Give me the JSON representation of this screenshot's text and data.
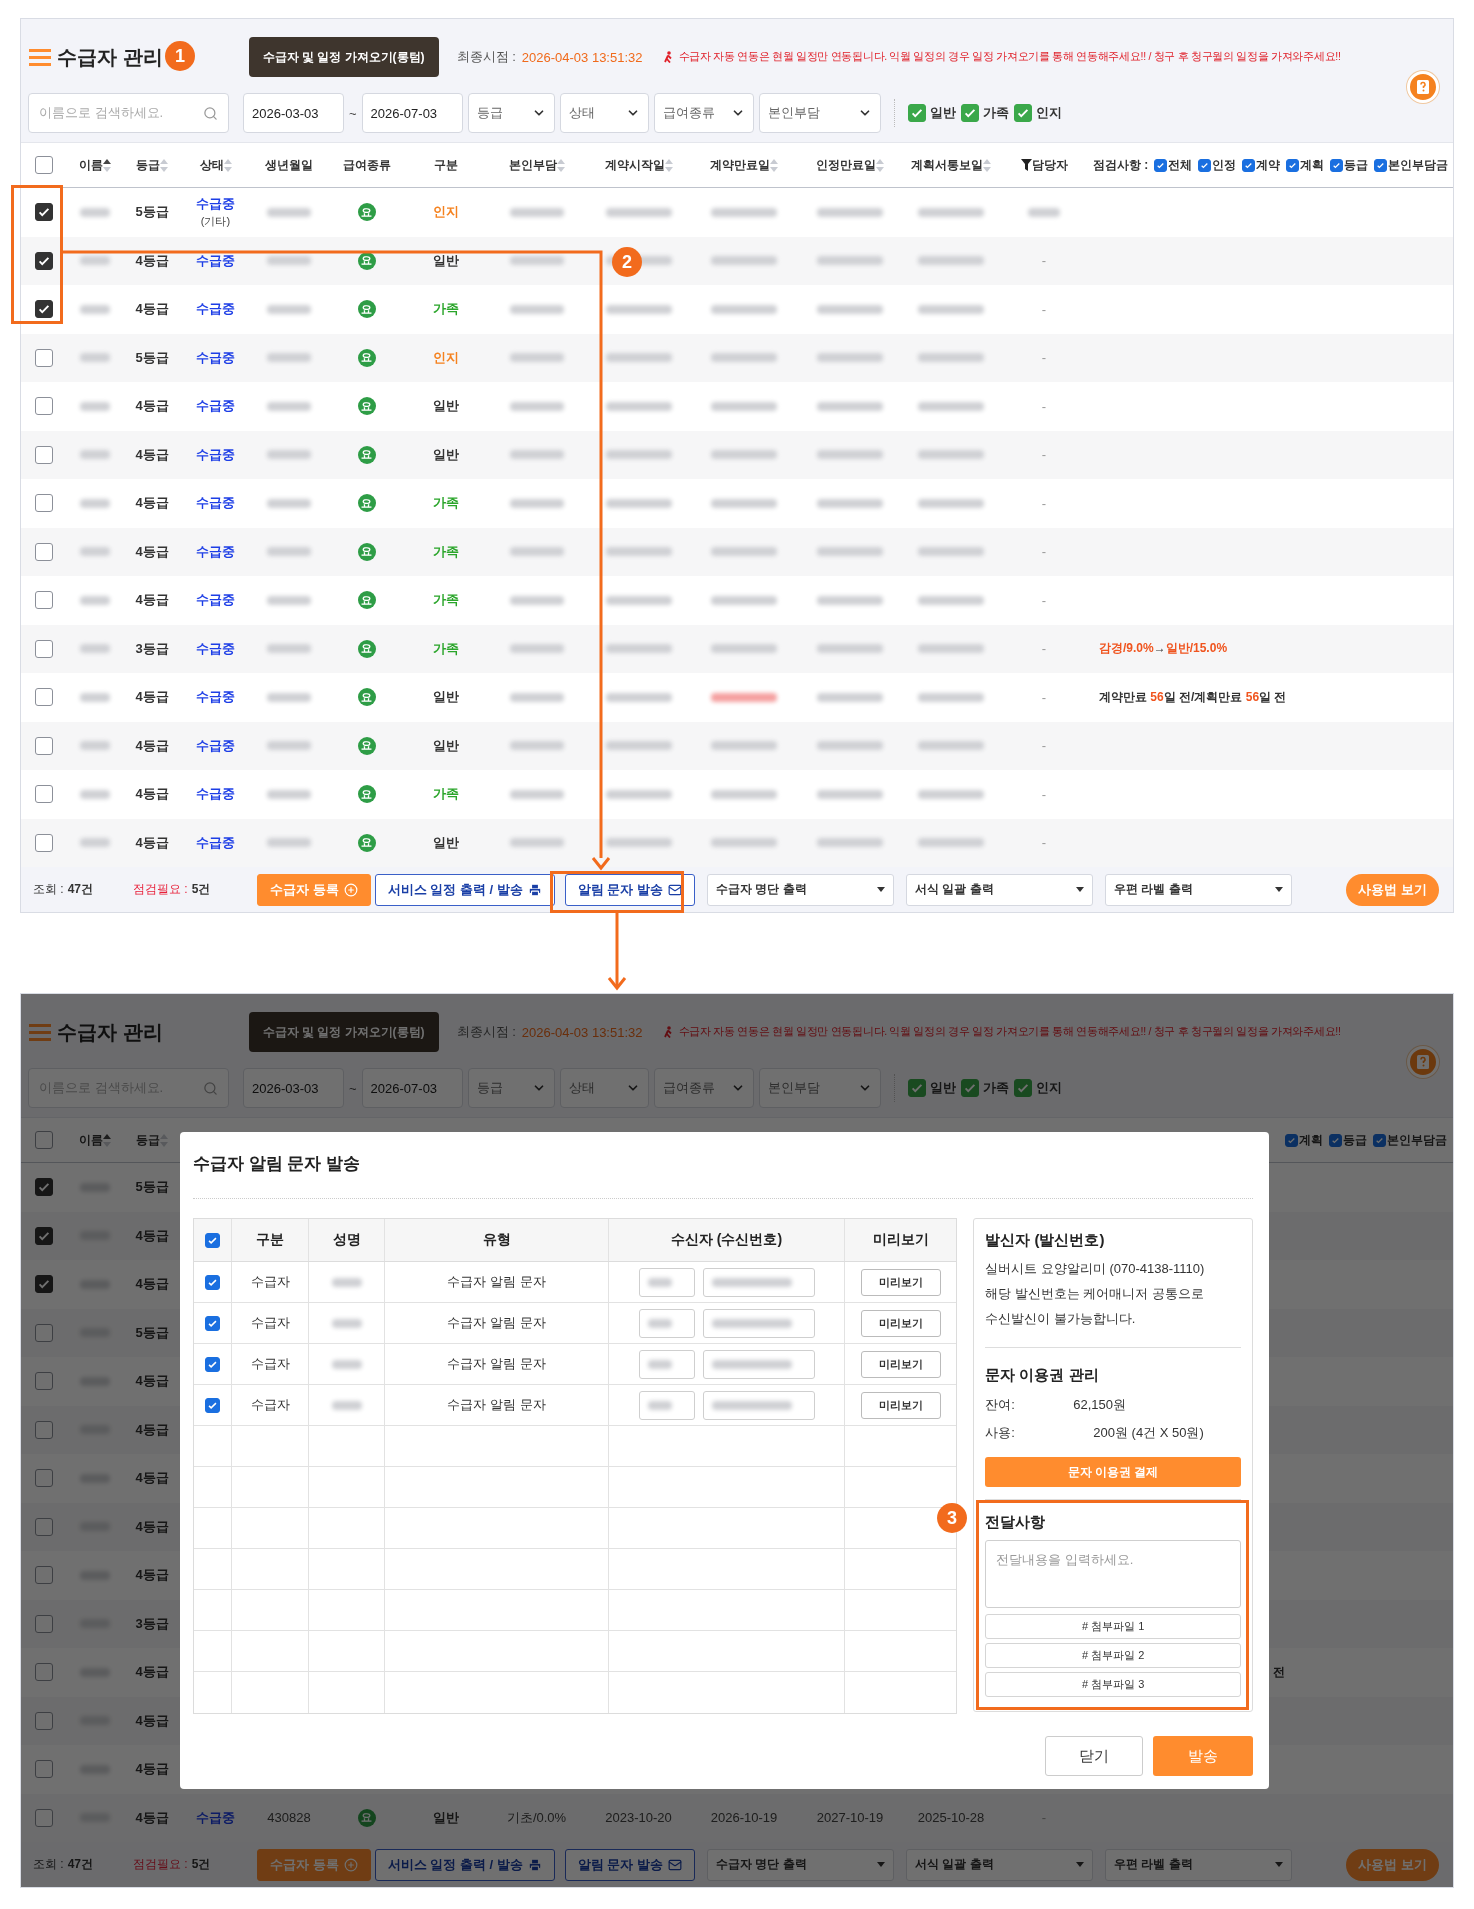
{
  "list_screen": {
    "header": {
      "title": "수급자 관리",
      "import_button": "수급자 및 일정 가져오기(롱텀)",
      "sync_label": "최종시점 :",
      "sync_time": "2026-04-03 13:51:32",
      "notice": "수급자 자동 연동은 현월 일정만 연동됩니다. 익월 일정의 경우 일정 가져오기를 통해 연동해주세요!! / 청구 후 청구월의 일정을 가져와주세요!!"
    },
    "filters": {
      "search_placeholder": "이름으로 검색하세요.",
      "date_from": "2026-03-03",
      "date_sep": "~",
      "date_to": "2026-07-03",
      "selects": [
        "등급",
        "상태",
        "급여종류",
        "본인부담"
      ],
      "toggles": [
        {
          "label": "일반",
          "checked": true
        },
        {
          "label": "가족",
          "checked": true
        },
        {
          "label": "인지",
          "checked": true
        }
      ]
    },
    "table": {
      "select_all": false,
      "columns": [
        {
          "label": "이름",
          "sorted": true
        },
        {
          "label": "등급",
          "sorted": false
        },
        {
          "label": "상태",
          "sorted": false
        },
        {
          "label": "생년월일"
        },
        {
          "label": "급여종류"
        },
        {
          "label": "구분"
        },
        {
          "label": "본인부담",
          "sorted": false
        },
        {
          "label": "계약시작일",
          "sorted": false
        },
        {
          "label": "계약만료일",
          "sorted": false
        },
        {
          "label": "인정만료일",
          "sorted": false
        },
        {
          "label": "계획서통보일",
          "sorted": false
        },
        {
          "label": "담당자",
          "filter": true
        }
      ],
      "notes_header": {
        "label": "점검사항 :",
        "checks": [
          {
            "label": "전체",
            "checked": true
          },
          {
            "label": "인정",
            "checked": true
          },
          {
            "label": "계약",
            "checked": true
          },
          {
            "label": "계획",
            "checked": true
          },
          {
            "label": "등급",
            "checked": true
          },
          {
            "label": "본인부담금",
            "checked": true
          }
        ]
      },
      "rows": [
        {
          "checked": true,
          "grade": "5등급",
          "status": "수급중",
          "status_note": "(기타)",
          "benefit": "요",
          "type": "인지",
          "color": "#f5821f",
          "contract_end_alert": false
        },
        {
          "checked": true,
          "grade": "4등급",
          "status": "수급중",
          "benefit": "요",
          "type": "일반",
          "color": "#333333",
          "contract_end_alert": false,
          "manager": "-"
        },
        {
          "checked": true,
          "grade": "4등급",
          "status": "수급중",
          "benefit": "요",
          "type": "가족",
          "color": "#2aa52a",
          "contract_end_alert": false,
          "manager": "-"
        },
        {
          "checked": false,
          "grade": "5등급",
          "status": "수급중",
          "benefit": "요",
          "type": "인지",
          "color": "#f5821f",
          "contract_end_alert": false,
          "manager": "-"
        },
        {
          "checked": false,
          "grade": "4등급",
          "status": "수급중",
          "benefit": "요",
          "type": "일반",
          "color": "#333333",
          "contract_end_alert": false,
          "manager": "-"
        },
        {
          "checked": false,
          "grade": "4등급",
          "status": "수급중",
          "benefit": "요",
          "type": "일반",
          "color": "#333333",
          "contract_end_alert": false,
          "manager": "-"
        },
        {
          "checked": false,
          "grade": "4등급",
          "status": "수급중",
          "benefit": "요",
          "type": "가족",
          "color": "#2aa52a",
          "contract_end_alert": false,
          "manager": "-"
        },
        {
          "checked": false,
          "grade": "4등급",
          "status": "수급중",
          "benefit": "요",
          "type": "가족",
          "color": "#2aa52a",
          "contract_end_alert": false,
          "manager": "-"
        },
        {
          "checked": false,
          "grade": "4등급",
          "status": "수급중",
          "benefit": "요",
          "type": "가족",
          "color": "#2aa52a",
          "contract_end_alert": false,
          "manager": "-"
        },
        {
          "checked": false,
          "grade": "3등급",
          "status": "수급중",
          "benefit": "요",
          "type": "가족",
          "color": "#2aa52a",
          "contract_end_alert": false,
          "manager": "-",
          "note": [
            {
              "text": "감경/9.0%",
              "alert": true
            },
            {
              "text": "→",
              "alert": false
            },
            {
              "text": "일반/15.0%",
              "alert": true
            }
          ]
        },
        {
          "checked": false,
          "grade": "4등급",
          "status": "수급중",
          "benefit": "요",
          "type": "일반",
          "color": "#333333",
          "contract_end_alert": true,
          "manager": "-",
          "note": [
            {
              "text": "계약만료 ",
              "alert": false
            },
            {
              "text": "56",
              "alert": true
            },
            {
              "text": "일 전/계획만료 ",
              "alert": false
            },
            {
              "text": "56",
              "alert": true
            },
            {
              "text": "일 전",
              "alert": false
            }
          ]
        },
        {
          "checked": false,
          "grade": "4등급",
          "status": "수급중",
          "benefit": "요",
          "type": "일반",
          "color": "#333333",
          "contract_end_alert": false,
          "manager": "-"
        },
        {
          "checked": false,
          "grade": "4등급",
          "status": "수급중",
          "benefit": "요",
          "type": "가족",
          "color": "#2aa52a",
          "contract_end_alert": false,
          "manager": "-"
        },
        {
          "checked": false,
          "grade": "4등급",
          "status": "수급중",
          "benefit": "요",
          "type": "일반",
          "color": "#333333",
          "contract_end_alert": false,
          "manager": "-"
        }
      ]
    },
    "footer": {
      "count_label": "조회 :",
      "count": "47건",
      "check_label": "점검필요 :",
      "check_count": "5건",
      "buttons": [
        "수급자 등록",
        "서비스 일정 출력 / 발송",
        "알림 문자 발송"
      ],
      "dropdowns": [
        "수급자 명단 출력",
        "서식 일괄 출력",
        "우편 라벨 출력"
      ],
      "help_button": "사용법 보기"
    }
  },
  "annotations": {
    "badges": [
      "1",
      "2",
      "3"
    ]
  },
  "dialog_screen": {
    "header": {
      "title": "수급자 관리",
      "import_button": "수급자 및 일정 가져오기(롱텀)",
      "sync_label": "최종시점 :",
      "sync_time": "2026-04-03 13:51:32",
      "notice": "수급자 자동 연동은 현월 일정만 연동됩니다. 익월 일정의 경우 일정 가져오기를 통해 연동해주세요!! / 청구 후 청구월의 일정을 가져와주세요!!"
    },
    "filters": {
      "search_placeholder": "이름으로 검색하세요.",
      "date_from": "2026-03-03",
      "date_sep": "~",
      "date_to": "2026-07-03",
      "selects": [
        "등급",
        "상태",
        "급여종류",
        "본인부담"
      ],
      "toggles": [
        {
          "label": "일반",
          "checked": true
        },
        {
          "label": "가족",
          "checked": true
        },
        {
          "label": "인지",
          "checked": true
        }
      ]
    },
    "table": {
      "select_all": false,
      "columns": [
        {
          "label": "이름",
          "sorted": true
        },
        {
          "label": "등급",
          "sorted": false
        }
      ],
      "notes_checks": [
        {
          "label": "계획",
          "checked": true
        },
        {
          "label": "등급",
          "checked": true
        },
        {
          "label": "본인부담금",
          "checked": true
        }
      ],
      "rows": [
        {
          "checked": true,
          "grade": "5등급"
        },
        {
          "checked": true,
          "grade": "4등급"
        },
        {
          "checked": true,
          "grade": "4등급"
        },
        {
          "checked": false,
          "grade": "5등급"
        },
        {
          "checked": false,
          "grade": "4등급"
        },
        {
          "checked": false,
          "grade": "4등급"
        },
        {
          "checked": false,
          "grade": "4등급"
        },
        {
          "checked": false,
          "grade": "4등급"
        },
        {
          "checked": false,
          "grade": "4등급"
        },
        {
          "checked": false,
          "grade": "3등급"
        },
        {
          "checked": false,
          "grade": "4등급",
          "note_tail": "전"
        },
        {
          "checked": false,
          "grade": "4등급"
        },
        {
          "checked": false,
          "grade": "4등급"
        },
        {
          "checked": false,
          "grade": "4등급",
          "status": "수급중",
          "birth": "430828",
          "benefit": "요",
          "type": "일반",
          "color": "#333333",
          "copay": "기초/0.0%",
          "contract_start": "2023-10-20",
          "contract_end": "2026-10-19",
          "contract_end_alert": false,
          "cert_end": "2027-10-19",
          "plan_notice": "2025-10-28",
          "manager": "-"
        }
      ]
    },
    "footer": {
      "count_label": "조회 :",
      "count": "47건",
      "check_label": "점검필요 :",
      "check_count": "5건",
      "buttons": [
        "수급자 등록",
        "서비스 일정 출력 / 발송",
        "알림 문자 발송"
      ],
      "dropdowns": [
        "수급자 명단 출력",
        "서식 일괄 출력",
        "우편 라벨 출력"
      ],
      "help_button": "사용법 보기"
    },
    "dialog": {
      "title": "수급자 알림 문자 발송",
      "select_all": true,
      "columns": [
        "구분",
        "성명",
        "유형",
        "수신자 (수신번호)",
        "미리보기"
      ],
      "rows": [
        {
          "checked": true,
          "category": "수급자",
          "type": "수급자 알림 문자",
          "preview": "미리보기"
        },
        {
          "checked": true,
          "category": "수급자",
          "type": "수급자 알림 문자",
          "preview": "미리보기"
        },
        {
          "checked": true,
          "category": "수급자",
          "type": "수급자 알림 문자",
          "preview": "미리보기"
        },
        {
          "checked": true,
          "category": "수급자",
          "type": "수급자 알림 문자",
          "preview": "미리보기"
        }
      ],
      "sender": {
        "title": "발신자 (발신번호)",
        "lines": [
          "실버시트 요양알리미 (070-4138-1110)",
          "해당 발신번호는 케어매니저 공통으로",
          "수신발신이 불가능합니다."
        ]
      },
      "ticket": {
        "title": "문자 이용권 관리",
        "balance_label": "잔여:",
        "balance": "62,150원",
        "usage_label": "사용:",
        "usage": "200원 (4건 X 50원)",
        "pay_button": "문자 이용권 결제"
      },
      "message": {
        "title": "전달사항",
        "placeholder": "전달내용을 입력하세요.",
        "attachments": [
          "# 첨부파일 1",
          "# 첨부파일 2",
          "# 첨부파일 3"
        ]
      },
      "close_button": "닫기",
      "send_button": "발송"
    }
  }
}
